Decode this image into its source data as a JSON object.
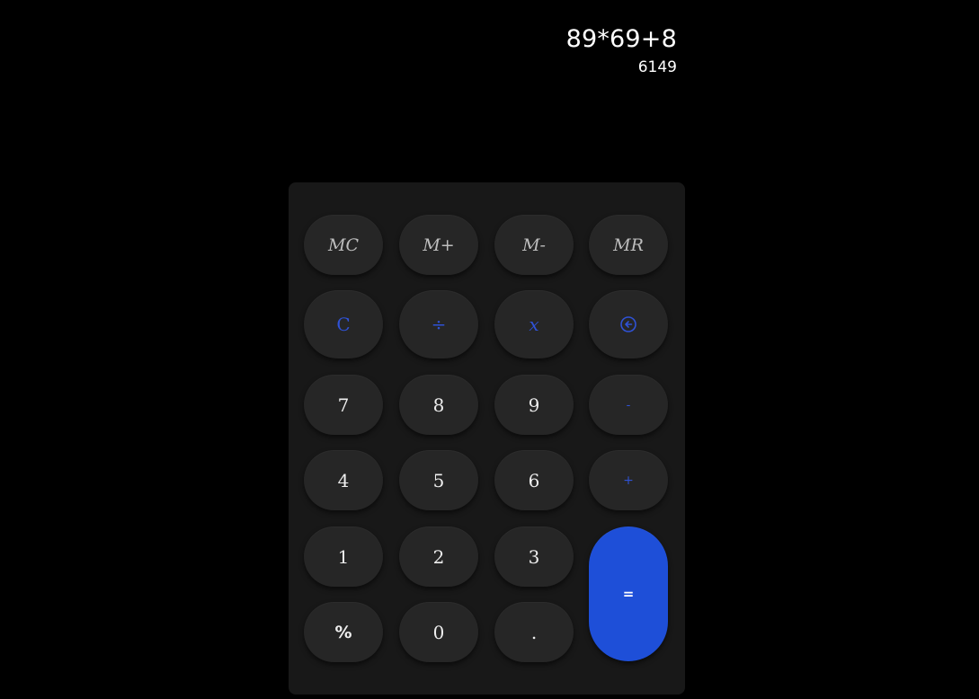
{
  "display": {
    "expression": "89*69+8",
    "result": "6149"
  },
  "keys": {
    "mc": "MC",
    "m_plus": "M+",
    "m_minus": "M-",
    "mr": "MR",
    "clear": "C",
    "divide": "÷",
    "multiply": "x",
    "backspace_icon": "backspace-icon",
    "seven": "7",
    "eight": "8",
    "nine": "9",
    "minus": "-",
    "four": "4",
    "five": "5",
    "six": "6",
    "plus": "+",
    "one": "1",
    "two": "2",
    "three": "3",
    "equals": "=",
    "percent": "%",
    "zero": "0",
    "decimal": "."
  },
  "colors": {
    "background": "#000000",
    "panel": "#181818",
    "key": "#262626",
    "accent": "#1e4fd8",
    "operator_text": "#2f52d6",
    "memory_text": "#bdbdbd",
    "digit_text": "#eeeeee"
  }
}
